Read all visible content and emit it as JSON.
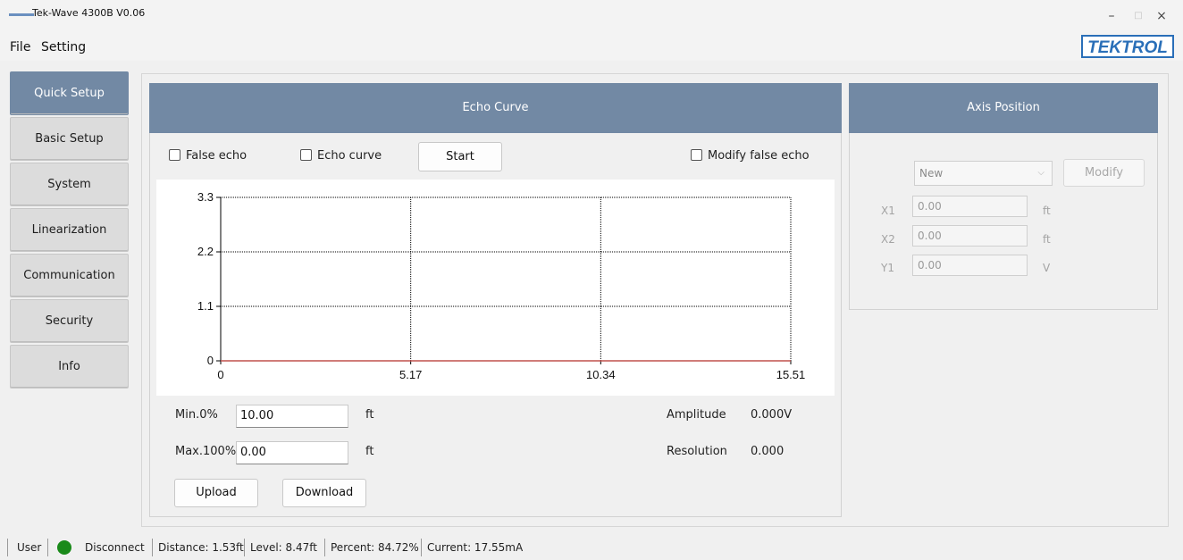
{
  "window": {
    "title": "Tek-Wave 4300B V0.06",
    "controls": {
      "minimize": "–",
      "maximize": "□",
      "close": "×"
    }
  },
  "menu": {
    "items": [
      "File",
      "Setting"
    ]
  },
  "brand": {
    "logo_text": "TEKTROL"
  },
  "sidebar": {
    "items": [
      {
        "label": "Quick Setup",
        "active": true
      },
      {
        "label": "Basic Setup",
        "active": false
      },
      {
        "label": "System",
        "active": false
      },
      {
        "label": "Linearization",
        "active": false
      },
      {
        "label": "Communication",
        "active": false
      },
      {
        "label": "Security",
        "active": false
      },
      {
        "label": "Info",
        "active": false
      }
    ]
  },
  "echo_panel": {
    "title": "Echo Curve",
    "false_echo_label": "False echo",
    "echo_curve_label": "Echo curve",
    "start_label": "Start",
    "modify_false_echo_label": "Modify false echo",
    "min_label": "Min.0%",
    "min_value": "10.00",
    "min_unit": "ft",
    "max_label": "Max.100%",
    "max_value": "0.00",
    "max_unit": "ft",
    "amplitude_label": "Amplitude",
    "amplitude_value": "0.000V",
    "resolution_label": "Resolution",
    "resolution_value": "0.000",
    "upload_label": "Upload",
    "download_label": "Download"
  },
  "chart_data": {
    "type": "line",
    "x_ticks": [
      "0",
      "5.17",
      "10.34",
      "15.51"
    ],
    "y_ticks": [
      "0",
      "1.1",
      "2.2",
      "3.3"
    ],
    "xlim": [
      0,
      15.51
    ],
    "ylim": [
      0,
      3.3
    ],
    "grid": true,
    "series": [
      {
        "x": [
          0,
          15.51
        ],
        "y": [
          0,
          0
        ],
        "color": "#c0504d"
      }
    ]
  },
  "axis_panel": {
    "title": "Axis Position",
    "select_value": "New",
    "modify_label": "Modify",
    "fields": [
      {
        "label": "X1",
        "value": "0.00",
        "unit": "ft"
      },
      {
        "label": "X2",
        "value": "0.00",
        "unit": "ft"
      },
      {
        "label": "Y1",
        "value": "0.00",
        "unit": "V"
      }
    ]
  },
  "status": {
    "user": "User",
    "connection": "Disconnect",
    "connection_color": "#1a8a1a",
    "distance": "Distance:  1.53ft",
    "level": "Level:  8.47ft",
    "percent": "Percent:  84.72%",
    "current": "Current:  17.55mA"
  },
  "colors": {
    "accent": "#7289a4"
  }
}
